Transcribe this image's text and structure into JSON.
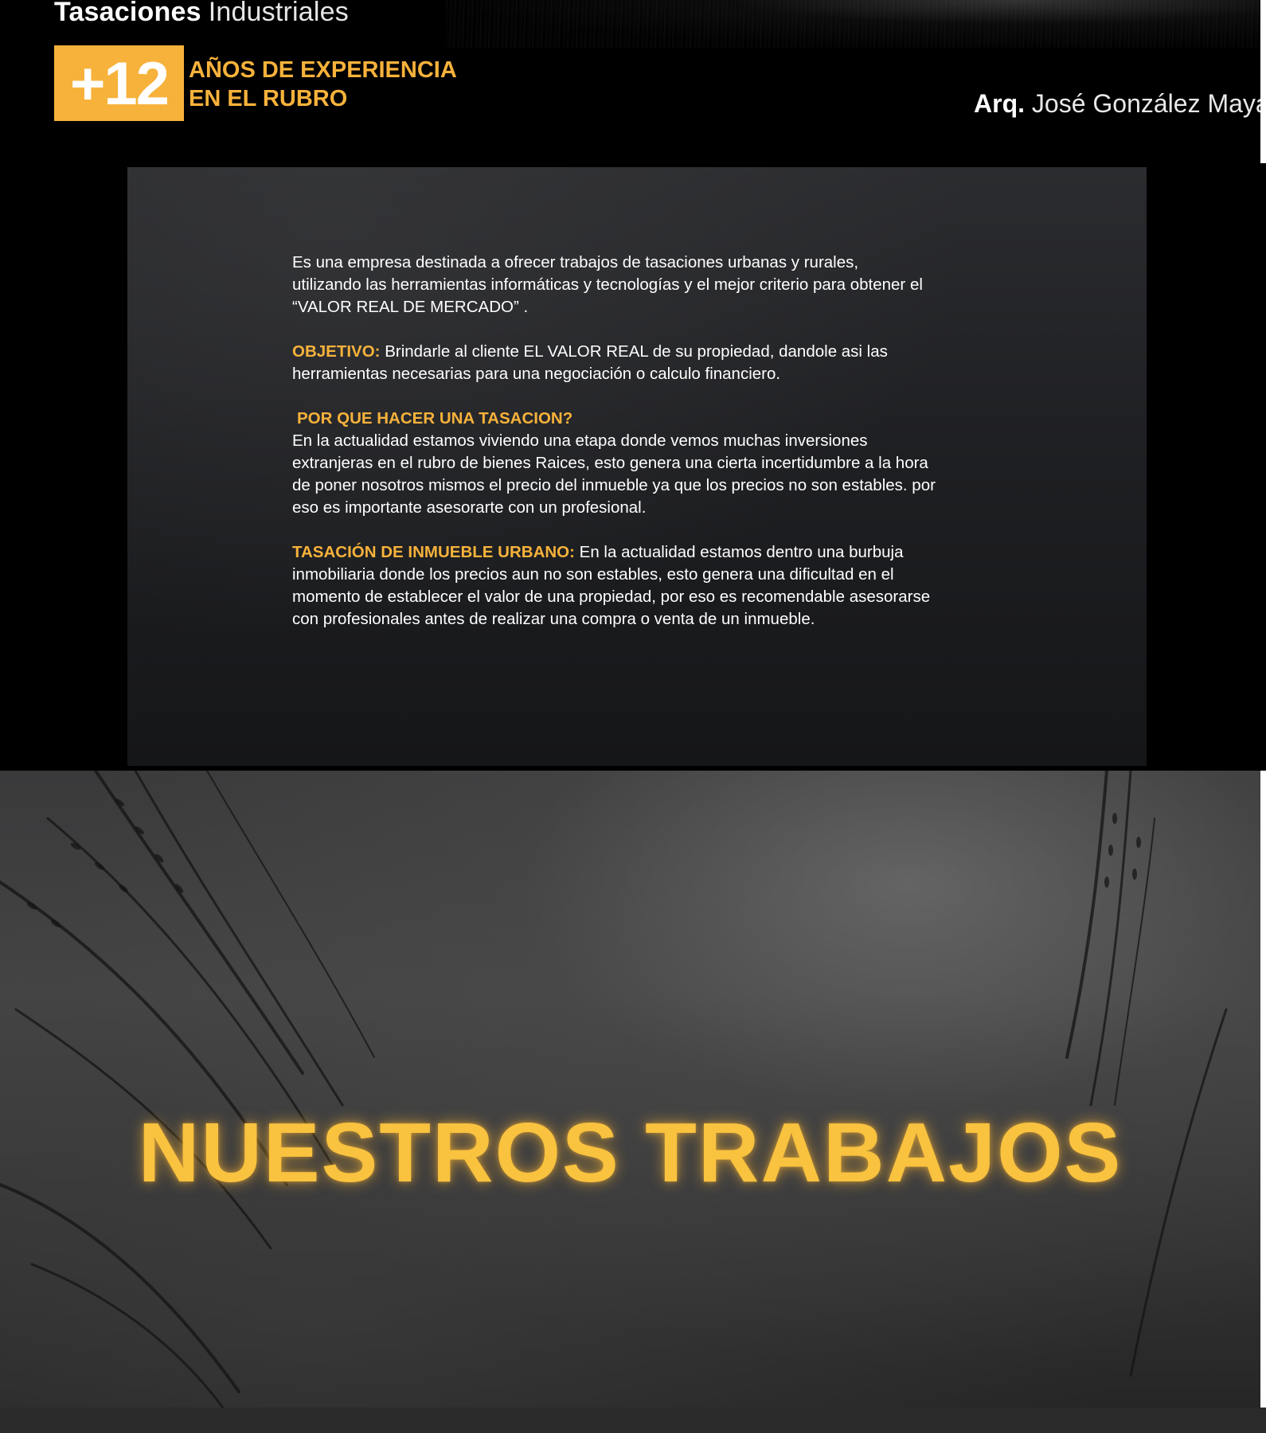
{
  "header": {
    "brand_strong": "Tasaciones",
    "brand_light": "Industriales",
    "experience_number": "+12",
    "experience_line1": "AÑOS DE EXPERIENCIA",
    "experience_line2": "EN EL RUBRO",
    "architect_title": "Arq.",
    "architect_name": "José González Maya V"
  },
  "info": {
    "intro_line1": "Es una empresa destinada a ofrecer trabajos de tasaciones urbanas y rurales,",
    "intro_line2": "utilizando las herramientas informáticas y tecnologías y el mejor criterio para obtener el",
    "intro_line3": "“VALOR REAL DE MERCADO” .",
    "objective_label": "OBJETIVO:",
    "objective_text_line1": " Brindarle al cliente EL VALOR REAL de su propiedad, dandole asi las",
    "objective_text_line2": "herramientas necesarias para una negociación o calculo financiero.",
    "why_heading": "POR QUE HACER UNA TASACION?",
    "why_line1": "En la actualidad estamos viviendo una etapa donde vemos muchas inversiones",
    "why_line2": "extranjeras en el rubro de bienes Raices, esto genera una cierta incertidumbre a la hora",
    "why_line3": "de poner nosotros mismos el precio del inmueble ya que los precios no son estables. por",
    "why_line4": "eso es importante asesorarte con un profesional.",
    "urban_label": "TASACIÓN DE INMUEBLE URBANO:",
    "urban_line1": " En la actualidad estamos dentro una burbuja",
    "urban_line2": "inmobiliaria donde los precios aun no son estables, esto genera una dificultad en el",
    "urban_line3": "momento de establecer el valor de una propiedad, por eso es recomendable asesorarse",
    "urban_line4": "con profesionales antes de realizar una compra o venta de un inmueble."
  },
  "hero": {
    "title": "NUESTROS TRABAJOS"
  },
  "colors": {
    "accent": "#f7b23b",
    "hero_title": "#f9c23f",
    "background": "#000000"
  }
}
